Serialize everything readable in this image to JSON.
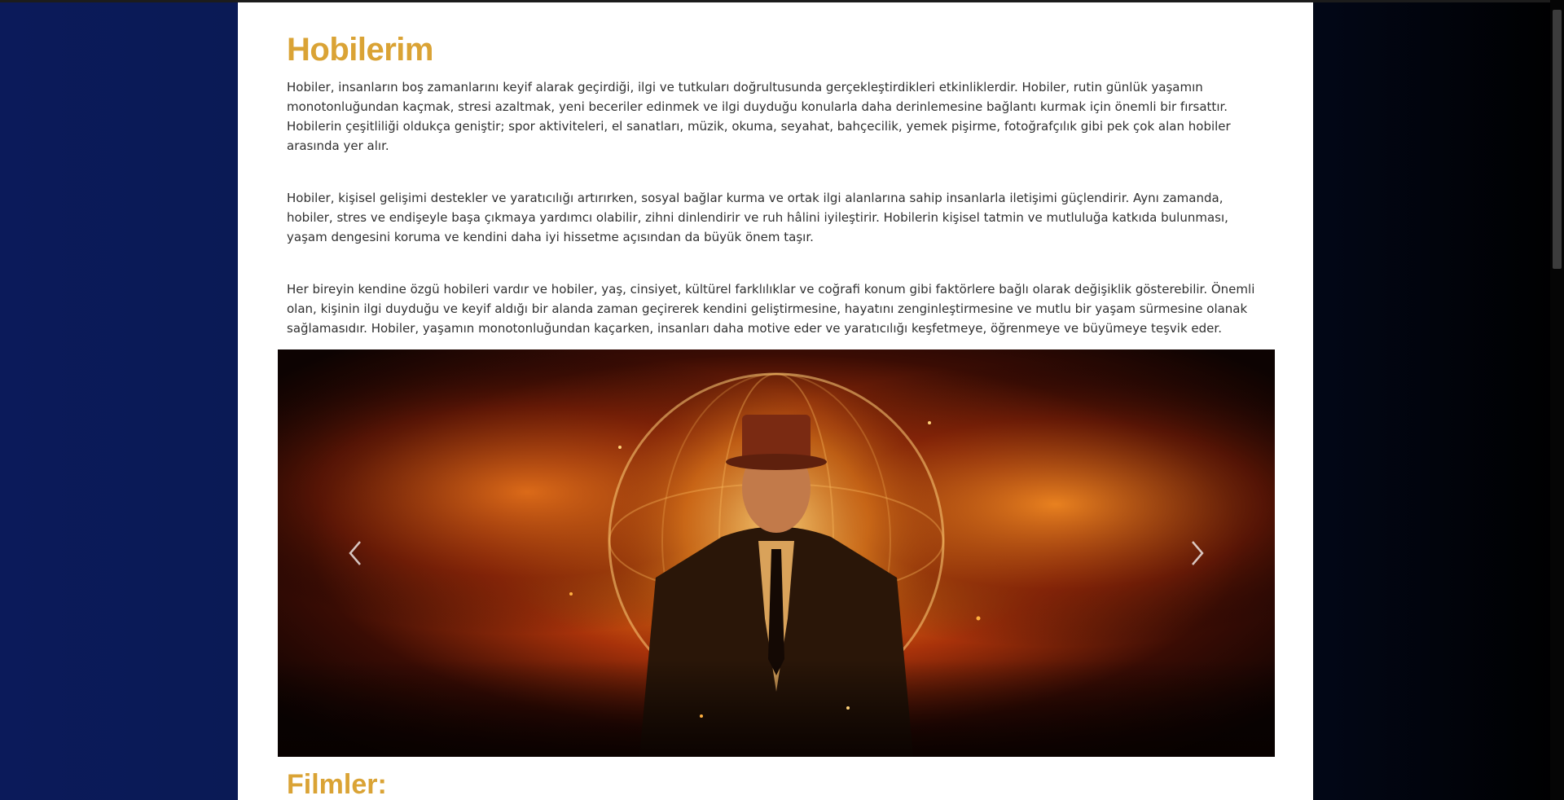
{
  "page": {
    "title": "Hobilerim",
    "paragraphs": [
      "Hobiler, insanların boş zamanlarını keyif alarak geçirdiği, ilgi ve tutkuları doğrultusunda gerçekleştirdikleri etkinliklerdir. Hobiler, rutin günlük yaşamın monotonluğundan kaçmak, stresi azaltmak, yeni beceriler edinmek ve ilgi duyduğu konularla daha derinlemesine bağlantı kurmak için önemli bir fırsattır. Hobilerin çeşitliliği oldukça geniştir; spor aktiviteleri, el sanatları, müzik, okuma, seyahat, bahçecilik, yemek pişirme, fotoğrafçılık gibi pek çok alan hobiler arasında yer alır.",
      "Hobiler, kişisel gelişimi destekler ve yaratıcılığı artırırken, sosyal bağlar kurma ve ortak ilgi alanlarına sahip insanlarla iletişimi güçlendirir. Aynı zamanda, hobiler, stres ve endişeyle başa çıkmaya yardımcı olabilir, zihni dinlendirir ve ruh hâlini iyileştirir. Hobilerin kişisel tatmin ve mutluluğa katkıda bulunması, yaşam dengesini koruma ve kendini daha iyi hissetme açısından da büyük önem taşır.",
      "Her bireyin kendine özgü hobileri vardır ve hobiler, yaş, cinsiyet, kültürel farklılıklar ve coğrafi konum gibi faktörlere bağlı olarak değişiklik gösterebilir. Önemli olan, kişinin ilgi duyduğu ve keyif aldığı bir alanda zaman geçirerek kendini geliştirmesine, hayatını zenginleştirmesine ve mutlu bir yaşam sürmesine olanak sağlamasıdır. Hobiler, yaşamın monotonluğundan kaçarken, insanları daha motive eder ve yaratıcılığı keşfetmeye, öğrenmeye ve büyümeye teşvik eder."
    ],
    "section_title": "Filmler:"
  },
  "carousel": {
    "prev_icon": "chevron-left-icon",
    "next_icon": "chevron-right-icon"
  },
  "colors": {
    "accent": "#daa335",
    "text": "#303030",
    "background_left": "#0b1a5a",
    "background_right": "#000000",
    "panel": "#ffffff"
  }
}
